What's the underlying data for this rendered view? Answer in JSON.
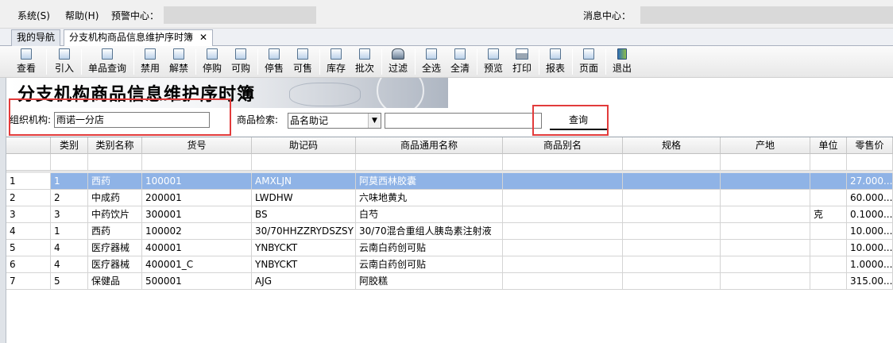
{
  "menu": {
    "system": "系统(S)",
    "help": "帮助(H)",
    "alert_center": "预警中心：",
    "message_center": "消息中心："
  },
  "tabs": [
    {
      "label": "我的导航"
    },
    {
      "label": "分支机构商品信息维护序时簿"
    }
  ],
  "toolbar": {
    "items": [
      "查看",
      "引入",
      "单品查询",
      "禁用",
      "解禁",
      "停购",
      "可购",
      "停售",
      "可售",
      "库存",
      "批次",
      "过滤",
      "全选",
      "全清",
      "预览",
      "打印",
      "报表",
      "页面",
      "退出"
    ]
  },
  "page_title": "分支机构商品信息维护序时簿",
  "query": {
    "org_label": "组织机构:",
    "org_value": "雨诺一分店",
    "goods_search_label": "商品检索:",
    "search_mode": "品名助记",
    "search_value": "",
    "query_button": "查询"
  },
  "grid": {
    "columns": [
      "类别",
      "类别名称",
      "货号",
      "助记码",
      "商品通用名称",
      "商品别名",
      "规格",
      "产地",
      "单位",
      "零售价"
    ],
    "rows": [
      {
        "no": "1",
        "cat": "1",
        "cat_name": "西药",
        "code": "100001",
        "mnemonic": "AMXLJN",
        "name": "阿莫西林胶囊",
        "alias": "",
        "spec": "",
        "origin": "",
        "unit": "",
        "price": "27.000..."
      },
      {
        "no": "2",
        "cat": "2",
        "cat_name": "中成药",
        "code": "200001",
        "mnemonic": "LWDHW",
        "name": "六味地黄丸",
        "alias": "",
        "spec": "",
        "origin": "",
        "unit": "",
        "price": "60.000..."
      },
      {
        "no": "3",
        "cat": "3",
        "cat_name": "中药饮片",
        "code": "300001",
        "mnemonic": "BS",
        "name": "白芍",
        "alias": "",
        "spec": "",
        "origin": "",
        "unit": "克",
        "price": "0.1000..."
      },
      {
        "no": "4",
        "cat": "1",
        "cat_name": "西药",
        "code": "100002",
        "mnemonic": "30/70HHZZRYDSZSY",
        "name": "30/70混合重组人胰岛素注射液",
        "alias": "",
        "spec": "",
        "origin": "",
        "unit": "",
        "price": "10.000..."
      },
      {
        "no": "5",
        "cat": "4",
        "cat_name": "医疗器械",
        "code": "400001",
        "mnemonic": "YNBYCKT",
        "name": "云南白药创可贴",
        "alias": "",
        "spec": "",
        "origin": "",
        "unit": "",
        "price": "10.000..."
      },
      {
        "no": "6",
        "cat": "4",
        "cat_name": "医疗器械",
        "code": "400001_C",
        "mnemonic": "YNBYCKT",
        "name": "云南白药创可贴",
        "alias": "",
        "spec": "",
        "origin": "",
        "unit": "",
        "price": "1.0000..."
      },
      {
        "no": "7",
        "cat": "5",
        "cat_name": "保健品",
        "code": "500001",
        "mnemonic": "AJG",
        "name": "阿胶糕",
        "alias": "",
        "spec": "",
        "origin": "",
        "unit": "",
        "price": "315.00..."
      }
    ]
  }
}
